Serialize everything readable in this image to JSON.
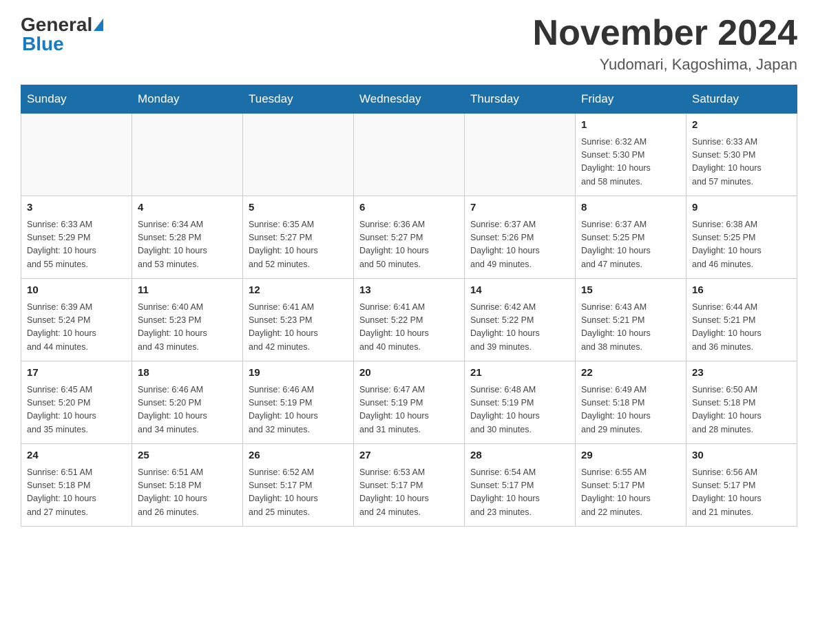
{
  "header": {
    "logo_general": "General",
    "logo_blue": "Blue",
    "month_title": "November 2024",
    "location": "Yudomari, Kagoshima, Japan"
  },
  "weekdays": [
    "Sunday",
    "Monday",
    "Tuesday",
    "Wednesday",
    "Thursday",
    "Friday",
    "Saturday"
  ],
  "weeks": [
    [
      {
        "day": "",
        "info": ""
      },
      {
        "day": "",
        "info": ""
      },
      {
        "day": "",
        "info": ""
      },
      {
        "day": "",
        "info": ""
      },
      {
        "day": "",
        "info": ""
      },
      {
        "day": "1",
        "info": "Sunrise: 6:32 AM\nSunset: 5:30 PM\nDaylight: 10 hours\nand 58 minutes."
      },
      {
        "day": "2",
        "info": "Sunrise: 6:33 AM\nSunset: 5:30 PM\nDaylight: 10 hours\nand 57 minutes."
      }
    ],
    [
      {
        "day": "3",
        "info": "Sunrise: 6:33 AM\nSunset: 5:29 PM\nDaylight: 10 hours\nand 55 minutes."
      },
      {
        "day": "4",
        "info": "Sunrise: 6:34 AM\nSunset: 5:28 PM\nDaylight: 10 hours\nand 53 minutes."
      },
      {
        "day": "5",
        "info": "Sunrise: 6:35 AM\nSunset: 5:27 PM\nDaylight: 10 hours\nand 52 minutes."
      },
      {
        "day": "6",
        "info": "Sunrise: 6:36 AM\nSunset: 5:27 PM\nDaylight: 10 hours\nand 50 minutes."
      },
      {
        "day": "7",
        "info": "Sunrise: 6:37 AM\nSunset: 5:26 PM\nDaylight: 10 hours\nand 49 minutes."
      },
      {
        "day": "8",
        "info": "Sunrise: 6:37 AM\nSunset: 5:25 PM\nDaylight: 10 hours\nand 47 minutes."
      },
      {
        "day": "9",
        "info": "Sunrise: 6:38 AM\nSunset: 5:25 PM\nDaylight: 10 hours\nand 46 minutes."
      }
    ],
    [
      {
        "day": "10",
        "info": "Sunrise: 6:39 AM\nSunset: 5:24 PM\nDaylight: 10 hours\nand 44 minutes."
      },
      {
        "day": "11",
        "info": "Sunrise: 6:40 AM\nSunset: 5:23 PM\nDaylight: 10 hours\nand 43 minutes."
      },
      {
        "day": "12",
        "info": "Sunrise: 6:41 AM\nSunset: 5:23 PM\nDaylight: 10 hours\nand 42 minutes."
      },
      {
        "day": "13",
        "info": "Sunrise: 6:41 AM\nSunset: 5:22 PM\nDaylight: 10 hours\nand 40 minutes."
      },
      {
        "day": "14",
        "info": "Sunrise: 6:42 AM\nSunset: 5:22 PM\nDaylight: 10 hours\nand 39 minutes."
      },
      {
        "day": "15",
        "info": "Sunrise: 6:43 AM\nSunset: 5:21 PM\nDaylight: 10 hours\nand 38 minutes."
      },
      {
        "day": "16",
        "info": "Sunrise: 6:44 AM\nSunset: 5:21 PM\nDaylight: 10 hours\nand 36 minutes."
      }
    ],
    [
      {
        "day": "17",
        "info": "Sunrise: 6:45 AM\nSunset: 5:20 PM\nDaylight: 10 hours\nand 35 minutes."
      },
      {
        "day": "18",
        "info": "Sunrise: 6:46 AM\nSunset: 5:20 PM\nDaylight: 10 hours\nand 34 minutes."
      },
      {
        "day": "19",
        "info": "Sunrise: 6:46 AM\nSunset: 5:19 PM\nDaylight: 10 hours\nand 32 minutes."
      },
      {
        "day": "20",
        "info": "Sunrise: 6:47 AM\nSunset: 5:19 PM\nDaylight: 10 hours\nand 31 minutes."
      },
      {
        "day": "21",
        "info": "Sunrise: 6:48 AM\nSunset: 5:19 PM\nDaylight: 10 hours\nand 30 minutes."
      },
      {
        "day": "22",
        "info": "Sunrise: 6:49 AM\nSunset: 5:18 PM\nDaylight: 10 hours\nand 29 minutes."
      },
      {
        "day": "23",
        "info": "Sunrise: 6:50 AM\nSunset: 5:18 PM\nDaylight: 10 hours\nand 28 minutes."
      }
    ],
    [
      {
        "day": "24",
        "info": "Sunrise: 6:51 AM\nSunset: 5:18 PM\nDaylight: 10 hours\nand 27 minutes."
      },
      {
        "day": "25",
        "info": "Sunrise: 6:51 AM\nSunset: 5:18 PM\nDaylight: 10 hours\nand 26 minutes."
      },
      {
        "day": "26",
        "info": "Sunrise: 6:52 AM\nSunset: 5:17 PM\nDaylight: 10 hours\nand 25 minutes."
      },
      {
        "day": "27",
        "info": "Sunrise: 6:53 AM\nSunset: 5:17 PM\nDaylight: 10 hours\nand 24 minutes."
      },
      {
        "day": "28",
        "info": "Sunrise: 6:54 AM\nSunset: 5:17 PM\nDaylight: 10 hours\nand 23 minutes."
      },
      {
        "day": "29",
        "info": "Sunrise: 6:55 AM\nSunset: 5:17 PM\nDaylight: 10 hours\nand 22 minutes."
      },
      {
        "day": "30",
        "info": "Sunrise: 6:56 AM\nSunset: 5:17 PM\nDaylight: 10 hours\nand 21 minutes."
      }
    ]
  ]
}
